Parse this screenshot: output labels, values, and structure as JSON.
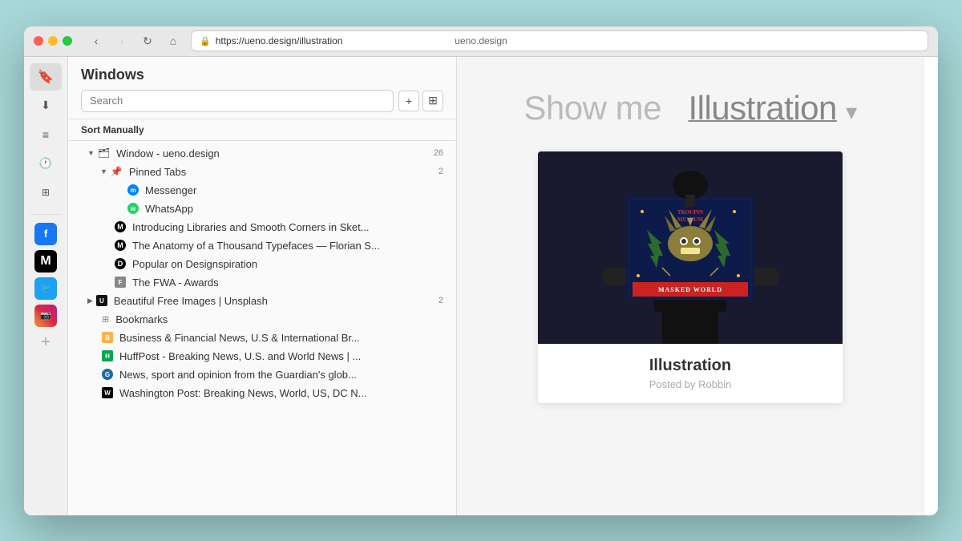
{
  "browser": {
    "domain": "ueno.design",
    "url": "https://ueno.design/illustration",
    "back_disabled": false,
    "forward_disabled": true
  },
  "titlebar": {
    "close": "close",
    "minimize": "minimize",
    "maximize": "maximize"
  },
  "sidebar_icons": [
    {
      "name": "bookmark-icon",
      "symbol": "🔖",
      "label": "Bookmarks"
    },
    {
      "name": "download-icon",
      "symbol": "⬇",
      "label": "Downloads"
    },
    {
      "name": "reader-icon",
      "symbol": "📄",
      "label": "Reader"
    },
    {
      "name": "history-icon",
      "symbol": "🕐",
      "label": "History"
    },
    {
      "name": "tabs-icon",
      "symbol": "⊞",
      "label": "Tabs"
    }
  ],
  "social_icons": [
    {
      "name": "facebook-icon",
      "label": "Facebook",
      "class": "fb",
      "text": "f"
    },
    {
      "name": "medium-icon",
      "label": "Medium",
      "class": "medium-social",
      "text": "M"
    },
    {
      "name": "twitter-icon",
      "label": "Twitter",
      "class": "twitter",
      "text": "t"
    },
    {
      "name": "instagram-icon",
      "label": "Instagram",
      "class": "instagram",
      "text": "✦"
    }
  ],
  "bookmarks_panel": {
    "title": "Windows",
    "search_placeholder": "Search",
    "sort_label": "Sort Manually",
    "add_button": "+",
    "new_tab_button": "⊞"
  },
  "tree_items": [
    {
      "id": "window-ueno",
      "indent": 1,
      "chevron": "down",
      "icon": "folder",
      "label": "Window - ueno.design",
      "count": "26"
    },
    {
      "id": "pinned-tabs",
      "indent": 2,
      "chevron": "down",
      "icon": "pin",
      "label": "Pinned Tabs",
      "count": "2"
    },
    {
      "id": "messenger",
      "indent": 3,
      "chevron": "none",
      "icon": "messenger",
      "label": "Messenger",
      "count": ""
    },
    {
      "id": "whatsapp",
      "indent": 3,
      "chevron": "none",
      "icon": "whatsapp",
      "label": "WhatsApp",
      "count": ""
    },
    {
      "id": "medium-libraries",
      "indent": 2,
      "chevron": "none",
      "icon": "medium",
      "label": "Introducing Libraries and Smooth Corners in Sket...",
      "count": ""
    },
    {
      "id": "medium-typefaces",
      "indent": 2,
      "chevron": "none",
      "icon": "medium",
      "label": "The Anatomy of a Thousand Typefaces — Florian S...",
      "count": ""
    },
    {
      "id": "designspiration",
      "indent": 2,
      "chevron": "none",
      "icon": "designspiration",
      "label": "Popular on Designspiration",
      "count": ""
    },
    {
      "id": "fwa",
      "indent": 2,
      "chevron": "none",
      "icon": "fwa",
      "label": "The FWA - Awards",
      "count": ""
    },
    {
      "id": "unsplash",
      "indent": 1,
      "chevron": "right",
      "icon": "unsplash",
      "label": "Beautiful Free Images | Unsplash",
      "count": "2"
    },
    {
      "id": "bookmarks",
      "indent": 1,
      "chevron": "none",
      "icon": "bookmarks",
      "label": "Bookmarks",
      "count": ""
    },
    {
      "id": "business",
      "indent": 1,
      "chevron": "none",
      "icon": "business",
      "label": "Business & Financial News, U.S & International Br...",
      "count": ""
    },
    {
      "id": "huffpost",
      "indent": 1,
      "chevron": "none",
      "icon": "huffpost",
      "label": "HuffPost - Breaking News, U.S. and World News | ...",
      "count": ""
    },
    {
      "id": "guardian",
      "indent": 1,
      "chevron": "none",
      "icon": "guardian",
      "label": "News, sport and opinion from the Guardian's glob...",
      "count": ""
    },
    {
      "id": "wapo",
      "indent": 1,
      "chevron": "none",
      "icon": "wapo",
      "label": "Washington Post: Breaking News, World, US, DC N...",
      "count": ""
    }
  ],
  "main": {
    "heading_prefix": "Show me",
    "heading_main": "Illustration",
    "heading_arrow": "▾",
    "card_title": "Illustration",
    "card_subtitle": "Posted by Robbin"
  }
}
